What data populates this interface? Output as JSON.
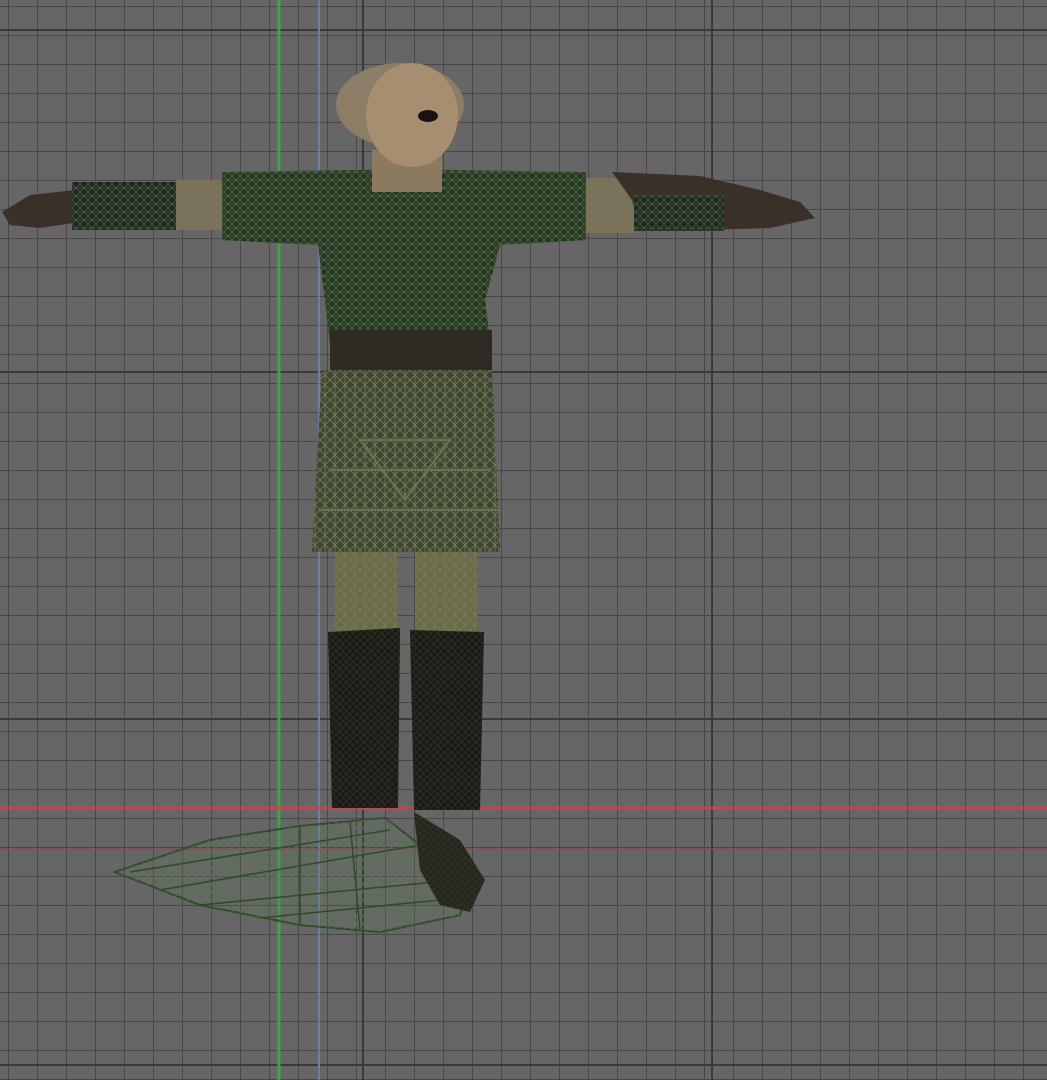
{
  "viewport": {
    "view": "front-orthographic",
    "background": "#666666",
    "grid_color": "#3f3f3f",
    "grid_major_color": "#2f2f2f",
    "axis_x_color": "#c4454f",
    "axis_z_color": "#3fa34a",
    "axis_secondary_color": "#6a7ea8"
  },
  "model": {
    "display": "wireframe",
    "colors": {
      "skin": "#9c8569",
      "skin_shadow": "#7a6a55",
      "tunic": "#23331f",
      "tunic_wire": "#4c6a42",
      "skirt": "#3d4630",
      "skirt_wire": "#6a7450",
      "legs": "#6b6a48",
      "boots": "#1a1a14",
      "gloves": "#3b2f2a",
      "belt": "#2f2a22",
      "cape_wire": "#2d4a2a"
    }
  }
}
